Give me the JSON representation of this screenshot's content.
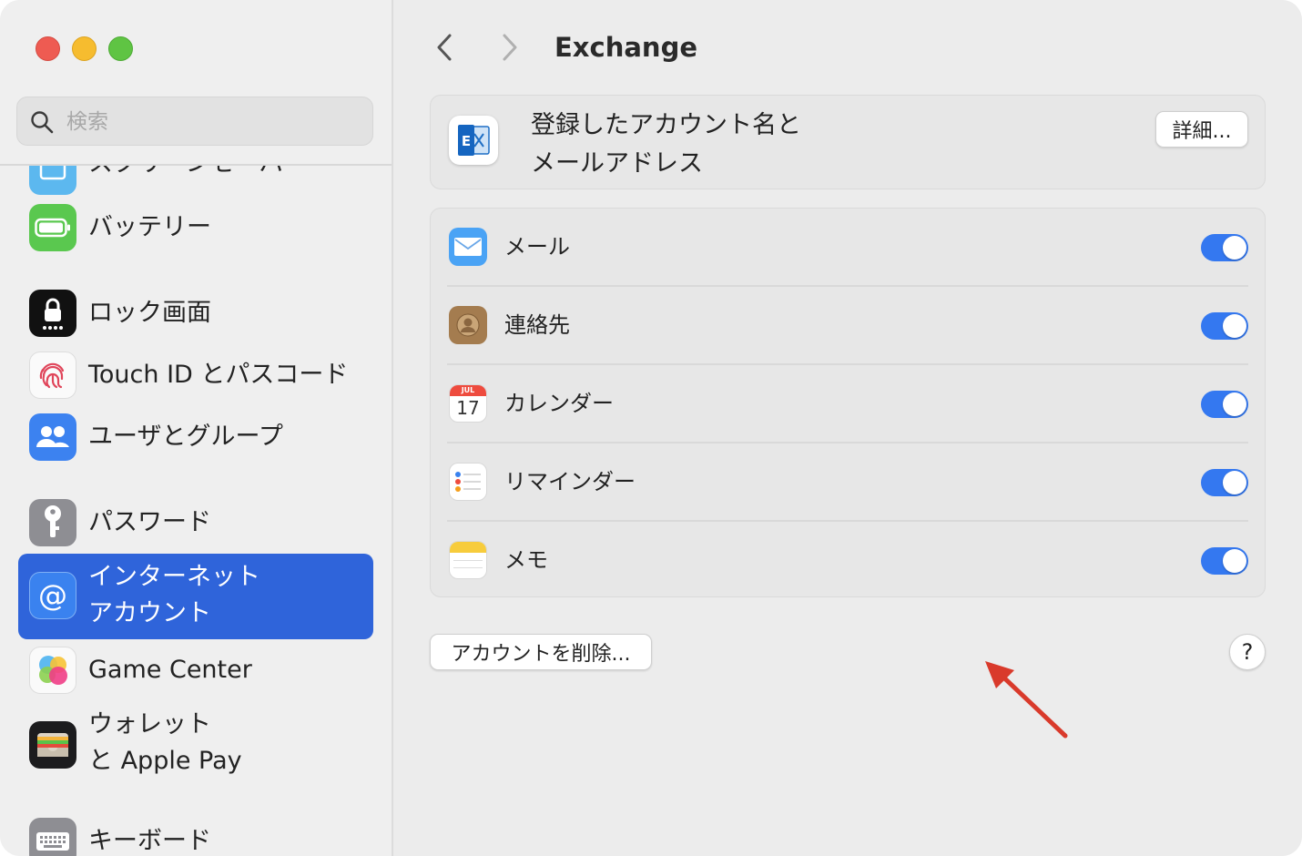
{
  "sidebar": {
    "search_placeholder": "検索",
    "items": [
      {
        "label": "スクリーンセーバ"
      },
      {
        "label": "バッテリー"
      },
      {
        "label": "ロック画面"
      },
      {
        "label": "Touch ID とパスコード"
      },
      {
        "label": "ユーザとグループ"
      },
      {
        "label": "パスワード"
      },
      {
        "label_line1": "インターネット",
        "label_line2": "アカウント"
      },
      {
        "label": "Game Center"
      },
      {
        "label_line1": "ウォレット",
        "label_line2": "と Apple Pay"
      },
      {
        "label": "キーボード"
      }
    ]
  },
  "header": {
    "title": "Exchange"
  },
  "account": {
    "name_line1": "登録したアカウント名と",
    "name_line2": "メールアドレス",
    "details_button": "詳細..."
  },
  "services": [
    {
      "label": "メール",
      "enabled": true
    },
    {
      "label": "連絡先",
      "enabled": true
    },
    {
      "label": "カレンダー",
      "enabled": true,
      "calendar_month": "JUL",
      "calendar_day": "17"
    },
    {
      "label": "リマインダー",
      "enabled": true
    },
    {
      "label": "メモ",
      "enabled": true
    }
  ],
  "delete_button": "アカウントを削除...",
  "help_label": "?",
  "colors": {
    "accent": "#2f64da",
    "toggle_on": "#3478f0",
    "annotation_arrow": "#d93a2b"
  }
}
